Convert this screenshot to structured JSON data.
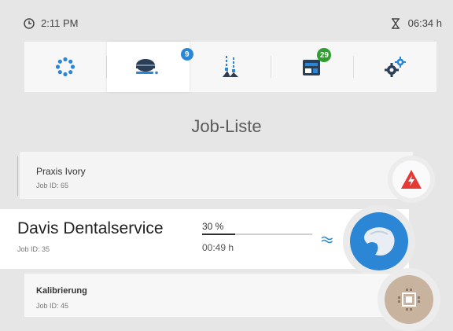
{
  "status": {
    "clock": "2:11 PM",
    "timer": "06:34 h"
  },
  "nav": {
    "tabs": [
      {
        "icon": "dots-ring-icon",
        "badge": ""
      },
      {
        "icon": "material-disc-icon",
        "badge": "9"
      },
      {
        "icon": "milling-tools-icon",
        "badge": ""
      },
      {
        "icon": "machine-icon",
        "badge": "29"
      },
      {
        "icon": "settings-gears-icon",
        "badge": ""
      }
    ],
    "active_index": 1
  },
  "page": {
    "title": "Job-Liste"
  },
  "jobs": [
    {
      "name": "Praxis Ivory",
      "id": "Job ID: 65",
      "status_icon": "error-warning-icon",
      "color": "#e53935"
    },
    {
      "name": "Davis Dentalservice",
      "id": "Job ID: 35",
      "progress_label": "30 %",
      "progress": 0.3,
      "time": "00:49 h",
      "status_icon": "crown-restoration-icon",
      "color": "#2b86d6"
    },
    {
      "name": "Kalibrierung",
      "id": "Job ID: 45",
      "status_icon": "calibration-block-icon",
      "color": "#c8b39e"
    }
  ],
  "colors": {
    "accent": "#2b86d6",
    "badge_blue": "#2b86d6",
    "badge_green": "#2e9e2e",
    "error": "#e53935"
  }
}
